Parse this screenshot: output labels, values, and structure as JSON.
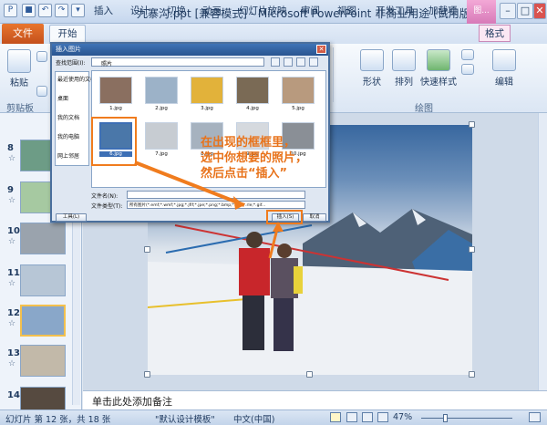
{
  "app": {
    "title": "九寨沟.ppt [兼容模式] - Microsoft PowerPoint 非商业用途 (试用版)",
    "context_tab": "图..."
  },
  "tabs": [
    "文件",
    "开始",
    "插入",
    "设计",
    "切换",
    "动画",
    "幻灯片放映",
    "审阅",
    "视图",
    "开发工具",
    "加载项",
    "格式"
  ],
  "ribbon": {
    "paste_label": "粘贴",
    "clipboard_group": "剪贴板",
    "shapes_label": "形状",
    "arrange_label": "排列",
    "quick_styles_label": "快速样式",
    "drawing_group": "绘图",
    "edit_label": "编辑"
  },
  "thumbnails": [
    {
      "num": "8",
      "star": "☆",
      "color": "#6d9c86"
    },
    {
      "num": "9",
      "star": "☆",
      "color": "#a6c9a1"
    },
    {
      "num": "10",
      "star": "☆",
      "color": "#9aa3ad"
    },
    {
      "num": "11",
      "star": "☆",
      "color": "#b7c6d6"
    },
    {
      "num": "12",
      "star": "☆",
      "color": "#89a7c9"
    },
    {
      "num": "13",
      "star": "☆",
      "color": "#c2b9a9"
    },
    {
      "num": "14",
      "star": "",
      "color": "#564a40"
    }
  ],
  "dialog": {
    "title": "插入图片",
    "look_in_label": "查找范围(I):",
    "look_in_value": "照片",
    "places": [
      "最近使用的文档",
      "桌面",
      "我的文档",
      "我的电脑",
      "网上邻居"
    ],
    "files": [
      "1.jpg",
      "2.jpg",
      "3.jpg",
      "4.jpg",
      "5.jpg",
      "6.jpg",
      "7.jpg",
      "8.jpg",
      "9.jpg",
      "10.jpg"
    ],
    "filename_label": "文件名(N):",
    "filetype_label": "文件类型(T):",
    "filetype_value": "所有图片(*.emf;*.wmf;*.jpg;*.jfif;*.jpe;*.png;*.bmp;*.dib;*.rle;*.gif...",
    "tools_label": "工具(L)",
    "insert_label": "插入(S)",
    "cancel_label": "取消"
  },
  "callout": {
    "line1": "在出现的框框里，",
    "line2": "选中你想要的照片，",
    "line3": "然后点击“插入”"
  },
  "notes_placeholder": "单击此处添加备注",
  "status": {
    "slide_info": "幻灯片 第 12 张，共 18 张",
    "theme": "\"默认设计模板\"",
    "language": "中文(中国)",
    "zoom": "47%"
  },
  "colors": {
    "file_tab": "#d0601f",
    "accent_orange": "#f07c1e",
    "title_bar": "#c6d7ee"
  }
}
